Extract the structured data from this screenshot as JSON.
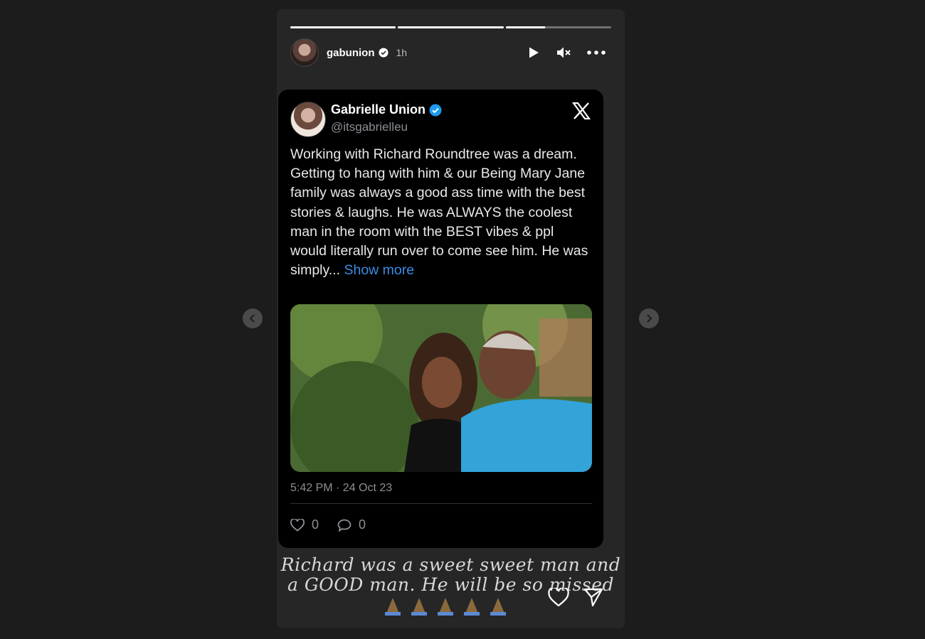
{
  "story": {
    "username": "gabunion",
    "time_ago": "1h",
    "progress": [
      1.0,
      1.0,
      0.37
    ],
    "caption": "Richard was a sweet sweet man and a GOOD man. He will be so missed",
    "emoji_count": 5
  },
  "tweet": {
    "name": "Gabrielle Union",
    "handle": "@itsgabrielleu",
    "text": "Working with Richard Roundtree was a dream. Getting to hang with him & our Being Mary Jane family was always a good ass time with the best stories & laughs. He was ALWAYS the coolest man in the room with the BEST vibes & ppl would literally run over to come see him. He was simply...",
    "show_more": "Show more",
    "timestamp": "5:42 PM · 24 Oct 23",
    "likes": "0",
    "replies": "0"
  },
  "colors": {
    "background": "#1c1c1c",
    "story_bg": "#262626",
    "tweet_bg": "#000000",
    "link_blue": "#3a8ee6",
    "verified_blue": "#1d9bf0"
  },
  "icons": [
    "verified-badge-icon",
    "play-icon",
    "mute-icon",
    "more-icon",
    "x-logo-icon",
    "heart-icon",
    "reply-icon",
    "share-icon",
    "chevron-left-icon",
    "chevron-right-icon",
    "praying-hands-icon"
  ]
}
